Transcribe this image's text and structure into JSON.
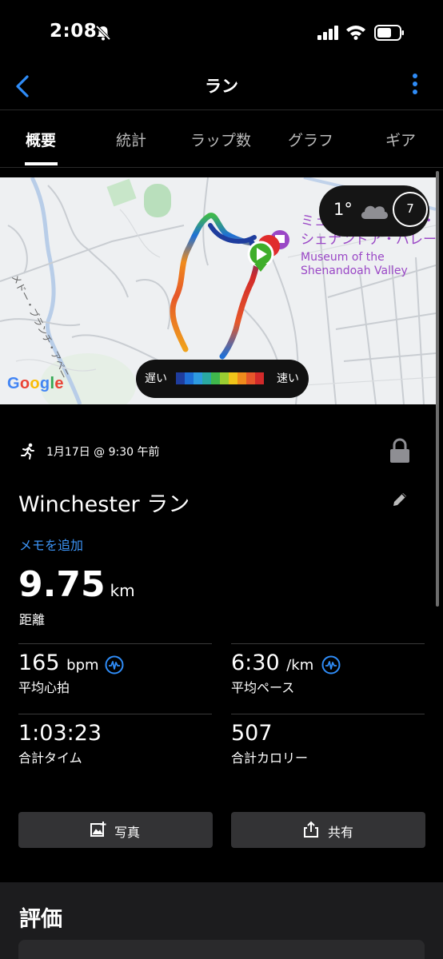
{
  "status_bar": {
    "time": "2:08"
  },
  "nav": {
    "title": "ラン"
  },
  "tabs": [
    {
      "label": "概要",
      "active": true
    },
    {
      "label": "統計"
    },
    {
      "label": "ラップ数"
    },
    {
      "label": "グラフ"
    },
    {
      "label": "ギア"
    }
  ],
  "map": {
    "weather": {
      "temperature": "1°",
      "wind": "7"
    },
    "poi": {
      "name_ja_line1": "ミュージアム・オブ・",
      "name_ja_line2": "シェナンドア・バレー",
      "name_en_line1": "Museum of the",
      "name_en_line2": "Shenandoah Valley"
    },
    "road_label": "メドー・ブランチ・アベニ",
    "attribution": {
      "G": "G",
      "o1": "o",
      "o2": "o",
      "g": "g",
      "l": "l",
      "e": "e"
    },
    "legend": {
      "slow": "遅い",
      "fast": "速い",
      "colors": [
        "#1f3d9e",
        "#1e6fd6",
        "#2e9be0",
        "#2aa9a2",
        "#3fb84c",
        "#9acd32",
        "#f0c419",
        "#f08b1c",
        "#e6572a",
        "#d22a2a"
      ]
    }
  },
  "activity": {
    "date": "1月17日 @ 9:30 午前",
    "name": "Winchester ラン",
    "add_note": "メモを追加",
    "distance": {
      "value": "9.75",
      "unit": "km",
      "label": "距離"
    }
  },
  "stats": {
    "heart_rate": {
      "value": "165",
      "unit": "bpm",
      "label": "平均心拍"
    },
    "pace": {
      "value": "6:30",
      "unit": "/km",
      "label": "平均ペース"
    },
    "time": {
      "value": "1:03:23",
      "label": "合計タイム"
    },
    "calories": {
      "value": "507",
      "label": "合計カロリー"
    }
  },
  "actions": {
    "photo": "写真",
    "share": "共有"
  },
  "rating": {
    "title": "評価"
  },
  "colors": {
    "accent": "#2f8cf7",
    "link": "#3c93f5",
    "background": "#000000",
    "button": "#333335"
  }
}
